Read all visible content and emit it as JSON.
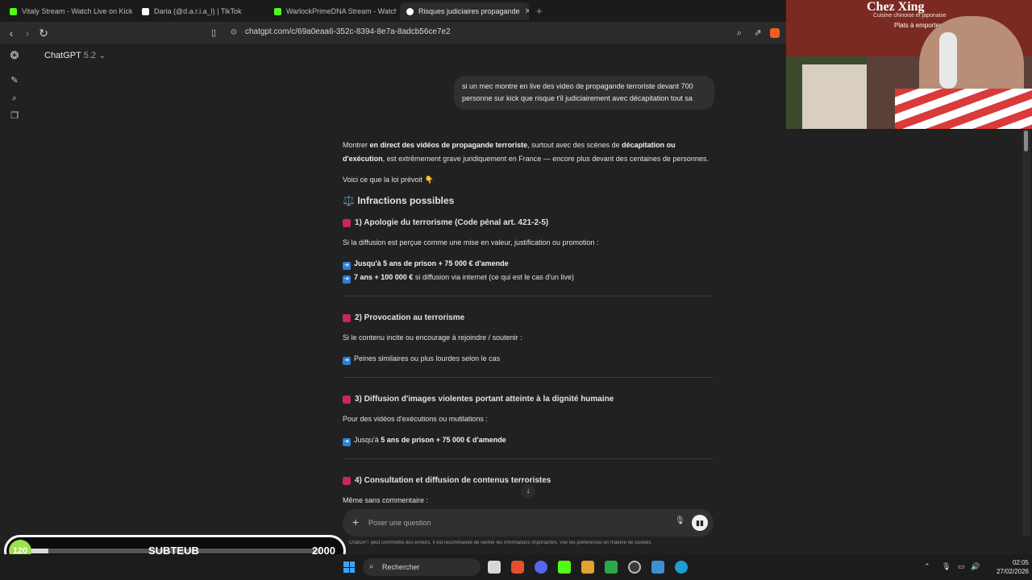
{
  "browser": {
    "tabs": [
      {
        "label": "Vitaly Stream - Watch Live on Kick",
        "color": "#53fc18",
        "active": false
      },
      {
        "label": "Daria (@d.a.r.i.a_l) | TikTok",
        "color": "#ffffff",
        "active": false
      },
      {
        "label": "WarlockPrimeDNA Stream - Watch Li",
        "color": "#53fc18",
        "active": false
      },
      {
        "label": "Risques judiciaires propagande",
        "color": "#ffffff",
        "active": true
      }
    ],
    "url": "chatgpt.com/c/69a0eaa6-352c-8394-8e7a-8adcb56ce7e2"
  },
  "chat": {
    "model_name": "ChatGPT",
    "model_version": "5.2",
    "user_message": "si un mec montre en live des video de propagande terroriste devant 700 personne sur kick que risque t'il judiciairement avec décapitation tout sa",
    "intro": {
      "t1": "Montrer ",
      "b1": "en direct des vidéos de propagande terroriste",
      "t2": ", surtout avec des scènes de ",
      "b2": "décapitation ou d'exécution",
      "t3": ", est extrêmement grave juridiquement en France — encore plus devant des centaines de personnes."
    },
    "lead": "Voici ce que la loi prévoit 👇",
    "section_title": "Infractions possibles",
    "section_icon": "⚖️",
    "s1": {
      "title": "1) Apologie du terrorisme (Code pénal art. 421-2-5)",
      "text": "Si la diffusion est perçue comme une mise en valeur, justification ou promotion :",
      "bullet1_bold": "Jusqu'à 5 ans de prison + 75 000 € d'amende",
      "bullet2_bold": "7 ans + 100 000 €",
      "bullet2_rest": " si diffusion via internet (ce qui est le cas d'un live)"
    },
    "s2": {
      "title": "2) Provocation au terrorisme",
      "text": "Si le contenu incite ou encourage à rejoindre / soutenir :",
      "bullet1": "Peines similaires ou plus lourdes selon le cas"
    },
    "s3": {
      "title": "3) Diffusion d'images violentes portant atteinte à la dignité humaine",
      "text": "Pour des vidéos d'exécutions ou mutilations :",
      "bullet1_pre": "Jusqu'à ",
      "bullet1_bold": "5 ans de prison + 75 000 € d'amende"
    },
    "s4": {
      "title": "4) Consultation et diffusion de contenus terroristes",
      "text": "Même sans commentaire :"
    },
    "composer_placeholder": "Poser une question",
    "disclaimer": "ChatGPT peut commettre des erreurs. Il est recommandé de vérifier les informations importantes. Voir les préférences en matière de cookies."
  },
  "overlay": {
    "webcam_sign": "Chez Xing",
    "webcam_sub": "Cuisine chinoise et japonaise",
    "webcam_sub2": "Plats à emporter",
    "sub_count": "120",
    "sub_label": "SUBTEUB",
    "sub_goal": "2000",
    "sub_progress": 0.06
  },
  "taskbar": {
    "search_label": "Rechercher",
    "time": "02:05",
    "date": "27/02/2026"
  }
}
